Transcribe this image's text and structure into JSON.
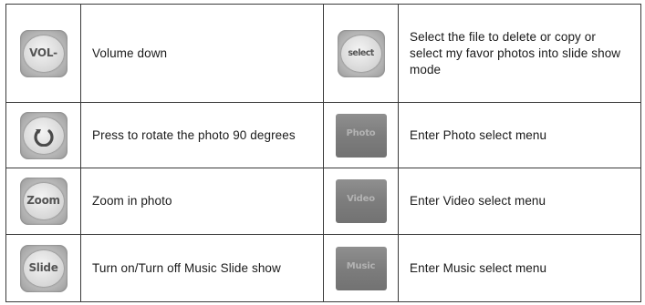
{
  "rows": [
    {
      "left": {
        "icon": "vol-minus-icon",
        "icon_text": "VOL-",
        "desc": "Volume down"
      },
      "right": {
        "icon": "select-icon",
        "icon_text": "select",
        "desc": "Select the file to delete or copy or select my favor photos into slide show mode"
      }
    },
    {
      "left": {
        "icon": "rotate-icon",
        "icon_text": "",
        "desc": "Press to rotate the photo 90 degrees"
      },
      "right": {
        "icon": "photo-icon",
        "icon_text": "Photo",
        "desc": "Enter Photo select menu"
      }
    },
    {
      "left": {
        "icon": "zoom-icon",
        "icon_text": "Zoom",
        "desc": "Zoom in photo"
      },
      "right": {
        "icon": "video-icon",
        "icon_text": "Video",
        "desc": "Enter Video select menu"
      }
    },
    {
      "left": {
        "icon": "slide-icon",
        "icon_text": "Slide",
        "desc": "Turn on/Turn off Music Slide show"
      },
      "right": {
        "icon": "music-icon",
        "icon_text": "Music",
        "desc": "Enter Music select menu"
      }
    }
  ],
  "colors": {
    "border": "#3a3a3a",
    "text": "#1a1a1a",
    "light_tile": "#c4c4c4",
    "dark_tile": "#7d7d7d"
  }
}
